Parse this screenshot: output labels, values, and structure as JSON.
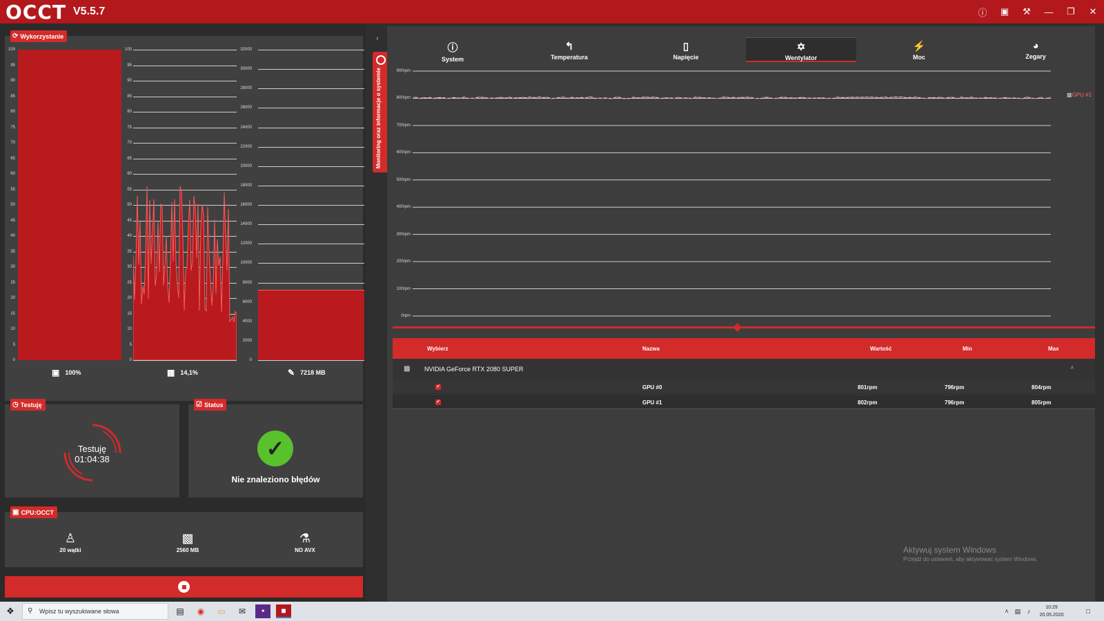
{
  "app": {
    "logo": "OCCT",
    "version": "V5.5.7"
  },
  "titlebar_icons": [
    "info-icon",
    "camera-icon",
    "wrench-icon",
    "minimize-icon",
    "restore-icon",
    "close-icon"
  ],
  "usage": {
    "tag": "Wykorzystanie",
    "cpu": {
      "value": 100,
      "label": "100%",
      "ticks": [
        "100",
        "95",
        "90",
        "85",
        "80",
        "75",
        "70",
        "65",
        "60",
        "55",
        "50",
        "45",
        "40",
        "35",
        "30",
        "25",
        "20",
        "15",
        "10",
        "5",
        "0"
      ]
    },
    "gpu": {
      "value": 14.1,
      "label": "14,1%",
      "ticks": [
        "100",
        "95",
        "90",
        "85",
        "80",
        "75",
        "70",
        "65",
        "60",
        "55",
        "50",
        "45",
        "40",
        "35",
        "30",
        "25",
        "20",
        "15",
        "10",
        "5",
        "0"
      ]
    },
    "ram": {
      "value": 7218,
      "label": "7218 MB",
      "ticks": [
        "32000",
        "30000",
        "28000",
        "26000",
        "24000",
        "22000",
        "20000",
        "18000",
        "16000",
        "14000",
        "12000",
        "10000",
        "8000",
        "6000",
        "4000",
        "2000",
        "0"
      ]
    }
  },
  "testing": {
    "tag": "Testuję",
    "title": "Testuję",
    "time": "01:04:38"
  },
  "status": {
    "tag": "Status",
    "message": "Nie znaleziono błędów",
    "color": "#58c12b"
  },
  "cpu_occt": {
    "tag": "CPU:OCCT",
    "items": [
      {
        "icon": "worker-icon",
        "label": "20 wątki"
      },
      {
        "icon": "chip-icon",
        "label": "2560 MB"
      },
      {
        "icon": "flask-icon",
        "label": "NO AVX"
      }
    ]
  },
  "side_tab": "Monitoring oraz informacje o systemie",
  "tabs": [
    {
      "icon": "info-icon",
      "label": "System"
    },
    {
      "icon": "thermometer-icon",
      "label": "Temperatura"
    },
    {
      "icon": "battery-icon",
      "label": "Napięcie"
    },
    {
      "icon": "fan-icon",
      "label": "Wentylator",
      "active": true
    },
    {
      "icon": "plug-icon",
      "label": "Moc"
    },
    {
      "icon": "gauge-icon",
      "label": "Zegary"
    }
  ],
  "chart_data": {
    "type": "line",
    "yticks": [
      "900rpm",
      "800rpm",
      "700rpm",
      "600rpm",
      "500rpm",
      "400rpm",
      "300rpm",
      "200rpm",
      "100rpm",
      "0rpm"
    ],
    "ylim": [
      0,
      900
    ],
    "series": [
      {
        "name": "GPU #1",
        "value": 802
      }
    ]
  },
  "table": {
    "headers": {
      "select": "Wybierz",
      "name": "Nazwa",
      "value": "Wartość",
      "min": "Min",
      "max": "Max"
    },
    "device": "NVIDIA GeForce RTX 2080 SUPER",
    "rows": [
      {
        "name": "GPU #0",
        "value": "801rpm",
        "min": "796rpm",
        "max": "804rpm"
      },
      {
        "name": "GPU #1",
        "value": "802rpm",
        "min": "796rpm",
        "max": "805rpm"
      }
    ]
  },
  "watermark": {
    "title": "Aktywuj system Windows",
    "subtitle": "Przejdź do ustawień, aby aktywować system Windows."
  },
  "taskbar": {
    "search_placeholder": "Wpisz tu wyszukiwane słowa",
    "time": "10:29",
    "date": "20.05.2020"
  }
}
